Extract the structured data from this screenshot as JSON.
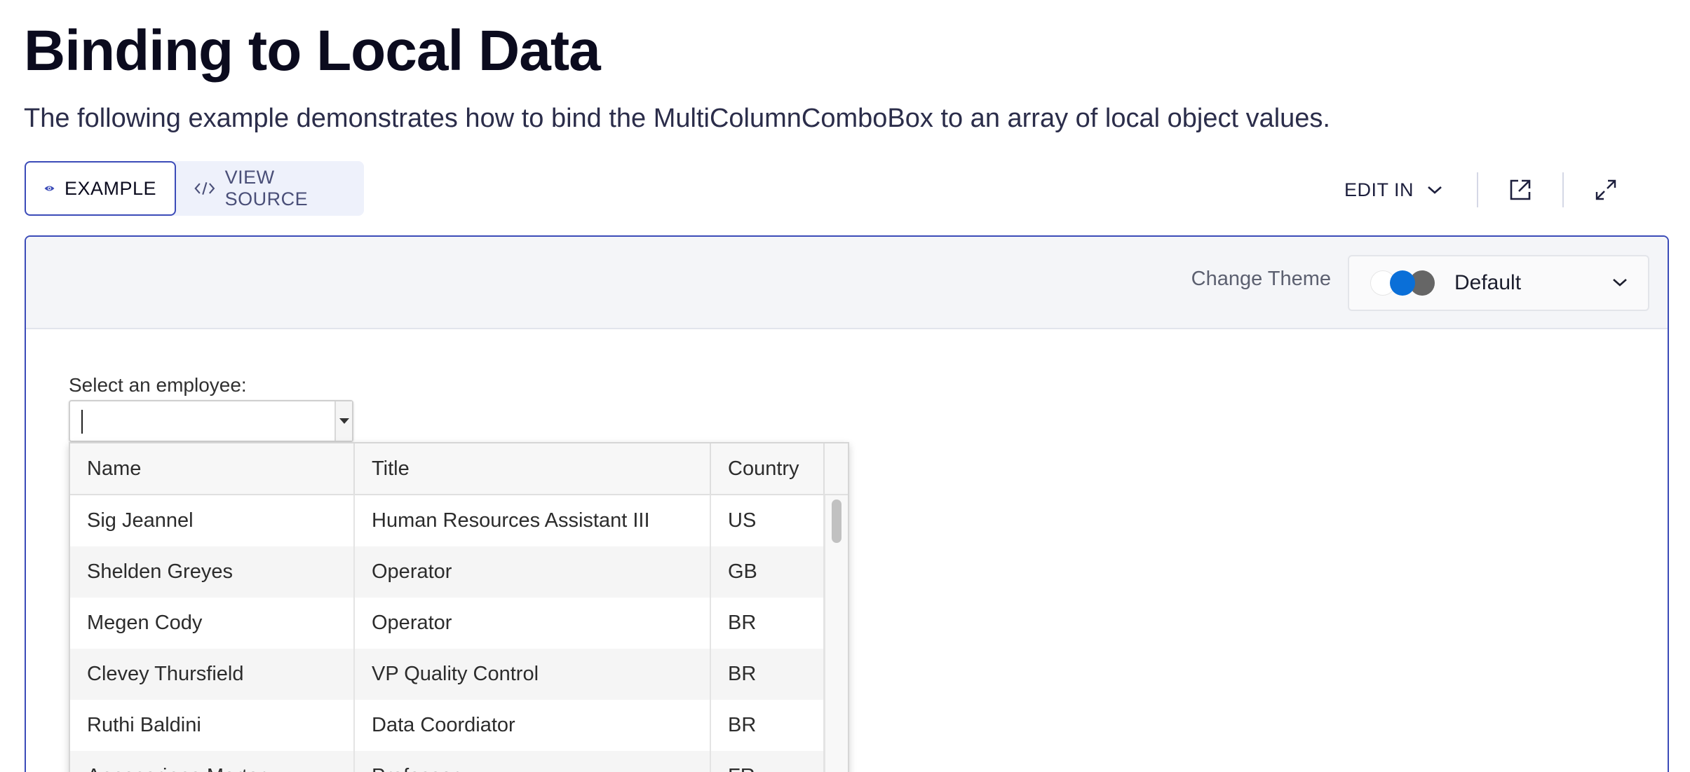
{
  "page": {
    "title": "Binding to Local Data",
    "description": "The following example demonstrates how to bind the MultiColumnComboBox to an array of local object values."
  },
  "tabs": {
    "example": "EXAMPLE",
    "view_source": "VIEW SOURCE"
  },
  "toolbar": {
    "edit_in": "EDIT IN"
  },
  "demo": {
    "theme_label": "Change Theme",
    "theme_value": "Default",
    "field_label": "Select an employee:",
    "combo_value": "",
    "columns": [
      "Name",
      "Title",
      "Country"
    ],
    "rows": [
      {
        "name": "Sig Jeannel",
        "title": "Human Resources Assistant III",
        "country": "US"
      },
      {
        "name": "Shelden Greyes",
        "title": "Operator",
        "country": "GB"
      },
      {
        "name": "Megen Cody",
        "title": "Operator",
        "country": "BR"
      },
      {
        "name": "Clevey Thursfield",
        "title": "VP Quality Control",
        "country": "BR"
      },
      {
        "name": "Ruthi Baldini",
        "title": "Data Coordiator",
        "country": "BR"
      },
      {
        "name": "Annecorinne Morter",
        "title": "Professor",
        "country": "FR"
      }
    ]
  },
  "colors": {
    "accent": "#3b4bb8",
    "theme_blue": "#0a6fd8"
  }
}
